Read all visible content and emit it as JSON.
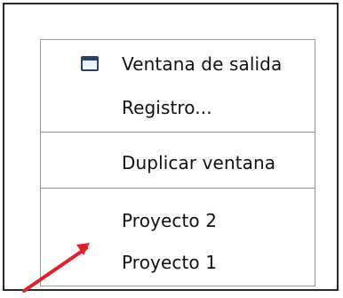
{
  "menu": {
    "items": [
      {
        "label": "Ventana de salida",
        "icon": "window-icon"
      },
      {
        "label": "Registro..."
      },
      {
        "label": "Duplicar ventana"
      },
      {
        "label": "Proyecto 2"
      },
      {
        "label": "Proyecto 1"
      }
    ]
  },
  "colors": {
    "arrow": "#e0202a",
    "separator": "#8f8f8f",
    "icon": "#2f3f63"
  }
}
